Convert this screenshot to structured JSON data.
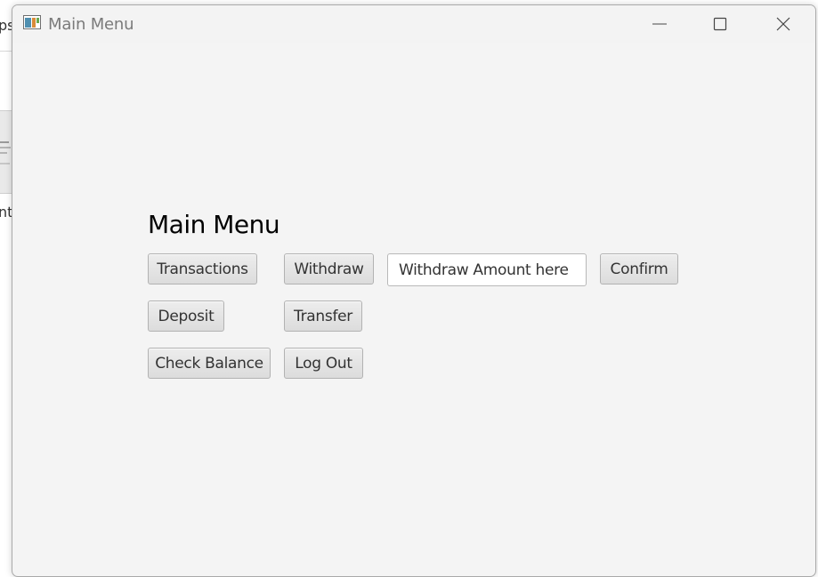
{
  "background": {
    "text_fragment_1": "ps",
    "text_fragment_2": "nt"
  },
  "window": {
    "title": "Main Menu",
    "controls": {
      "minimize": "minimize-icon",
      "maximize": "maximize-icon",
      "close": "close-icon"
    }
  },
  "main": {
    "heading": "Main Menu",
    "buttons": {
      "transactions": "Transactions",
      "withdraw": "Withdraw",
      "confirm": "Confirm",
      "deposit": "Deposit",
      "transfer": "Transfer",
      "check_balance": "Check Balance",
      "log_out": "Log Out"
    },
    "withdraw_input": {
      "value": "",
      "placeholder": "Withdraw Amount here"
    }
  },
  "colors": {
    "window_bg": "#f4f4f4",
    "button_border": "#b2b2b2",
    "title_text": "#7a7a7a"
  }
}
